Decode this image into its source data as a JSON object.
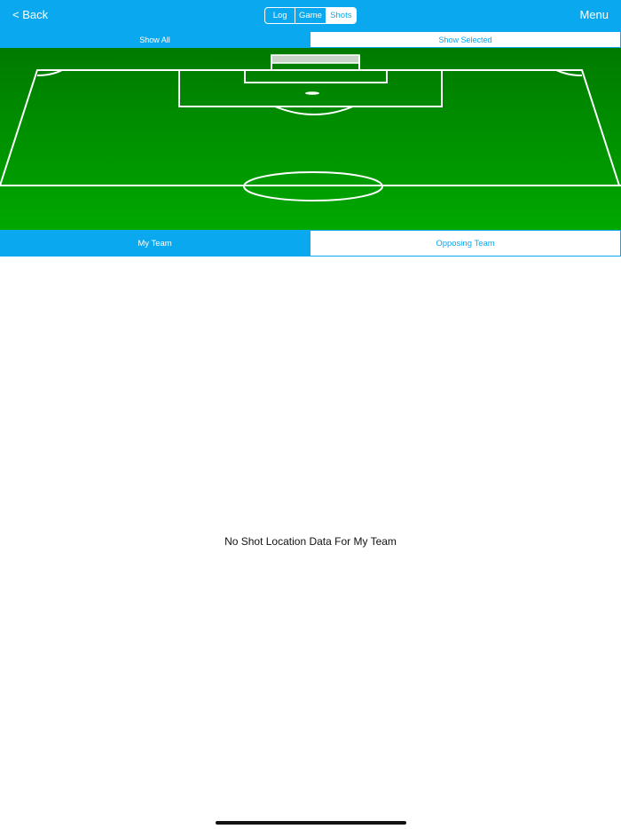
{
  "navbar": {
    "back_label": "< Back",
    "menu_label": "Menu",
    "segments": [
      {
        "label": "Log",
        "active": false
      },
      {
        "label": "Game",
        "active": false
      },
      {
        "label": "Shots",
        "active": true
      }
    ]
  },
  "filter": {
    "show_all_label": "Show All",
    "show_selected_label": "Show Selected",
    "selected": "Show All"
  },
  "teams": {
    "my_team_label": "My Team",
    "opposing_team_label": "Opposing Team",
    "selected": "My Team"
  },
  "main": {
    "empty_message": "No Shot Location Data For My Team"
  },
  "colors": {
    "accent": "#0aa8ef",
    "pitch_top": "#007a00",
    "pitch_bottom": "#00a800"
  }
}
